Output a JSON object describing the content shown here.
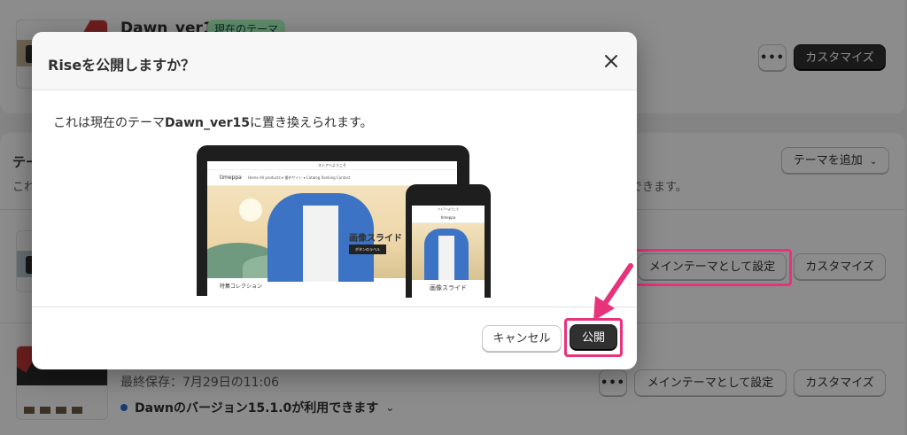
{
  "background": {
    "current_theme": {
      "name": "Dawn_ver15",
      "badge": "現在のテーマ"
    },
    "top_card": {
      "more_label": "•••",
      "customize_label": "カスタマイズ"
    },
    "library": {
      "title": "テー",
      "description": "これ",
      "description_right": "できます。",
      "add_theme_label": "テーマを追加",
      "rise_row": {
        "set_main_label": "メインテーマとして設定",
        "customize_label": "カスタマイズ"
      },
      "dawn_row": {
        "last_saved": "最終保存：7月29日の11:06",
        "update_notice": "Dawnのバージョン15.1.0が利用できます",
        "more_label": "•••",
        "set_main_label": "メインテーマとして設定",
        "customize_label": "カスタマイズ"
      }
    }
  },
  "modal": {
    "title": "Riseを公開しますか？",
    "body_prefix": "これは現在のテーマ",
    "body_theme": "Dawn_ver15",
    "body_suffix": "に置き換えられます。",
    "cancel_label": "キャンセル",
    "publish_label": "公開",
    "preview": {
      "announcement": "ストアへようこそ",
      "store_name": "timeppa",
      "nav_links": "Home   All products ▾   番外サイト ▾   Catalog   Ranking   Contact",
      "hero_text": "画像スライド",
      "hero_button": "ボタンのラベル",
      "collection_heading": "特集コレクション",
      "phone_announcement": "ストアへようこそ",
      "phone_store_name": "timeppa",
      "phone_hero_text": "画像スライド"
    }
  },
  "colors": {
    "highlight": "#e8327a",
    "primary": "#303030",
    "badge_bg": "#affebf",
    "badge_text": "#014b40"
  }
}
